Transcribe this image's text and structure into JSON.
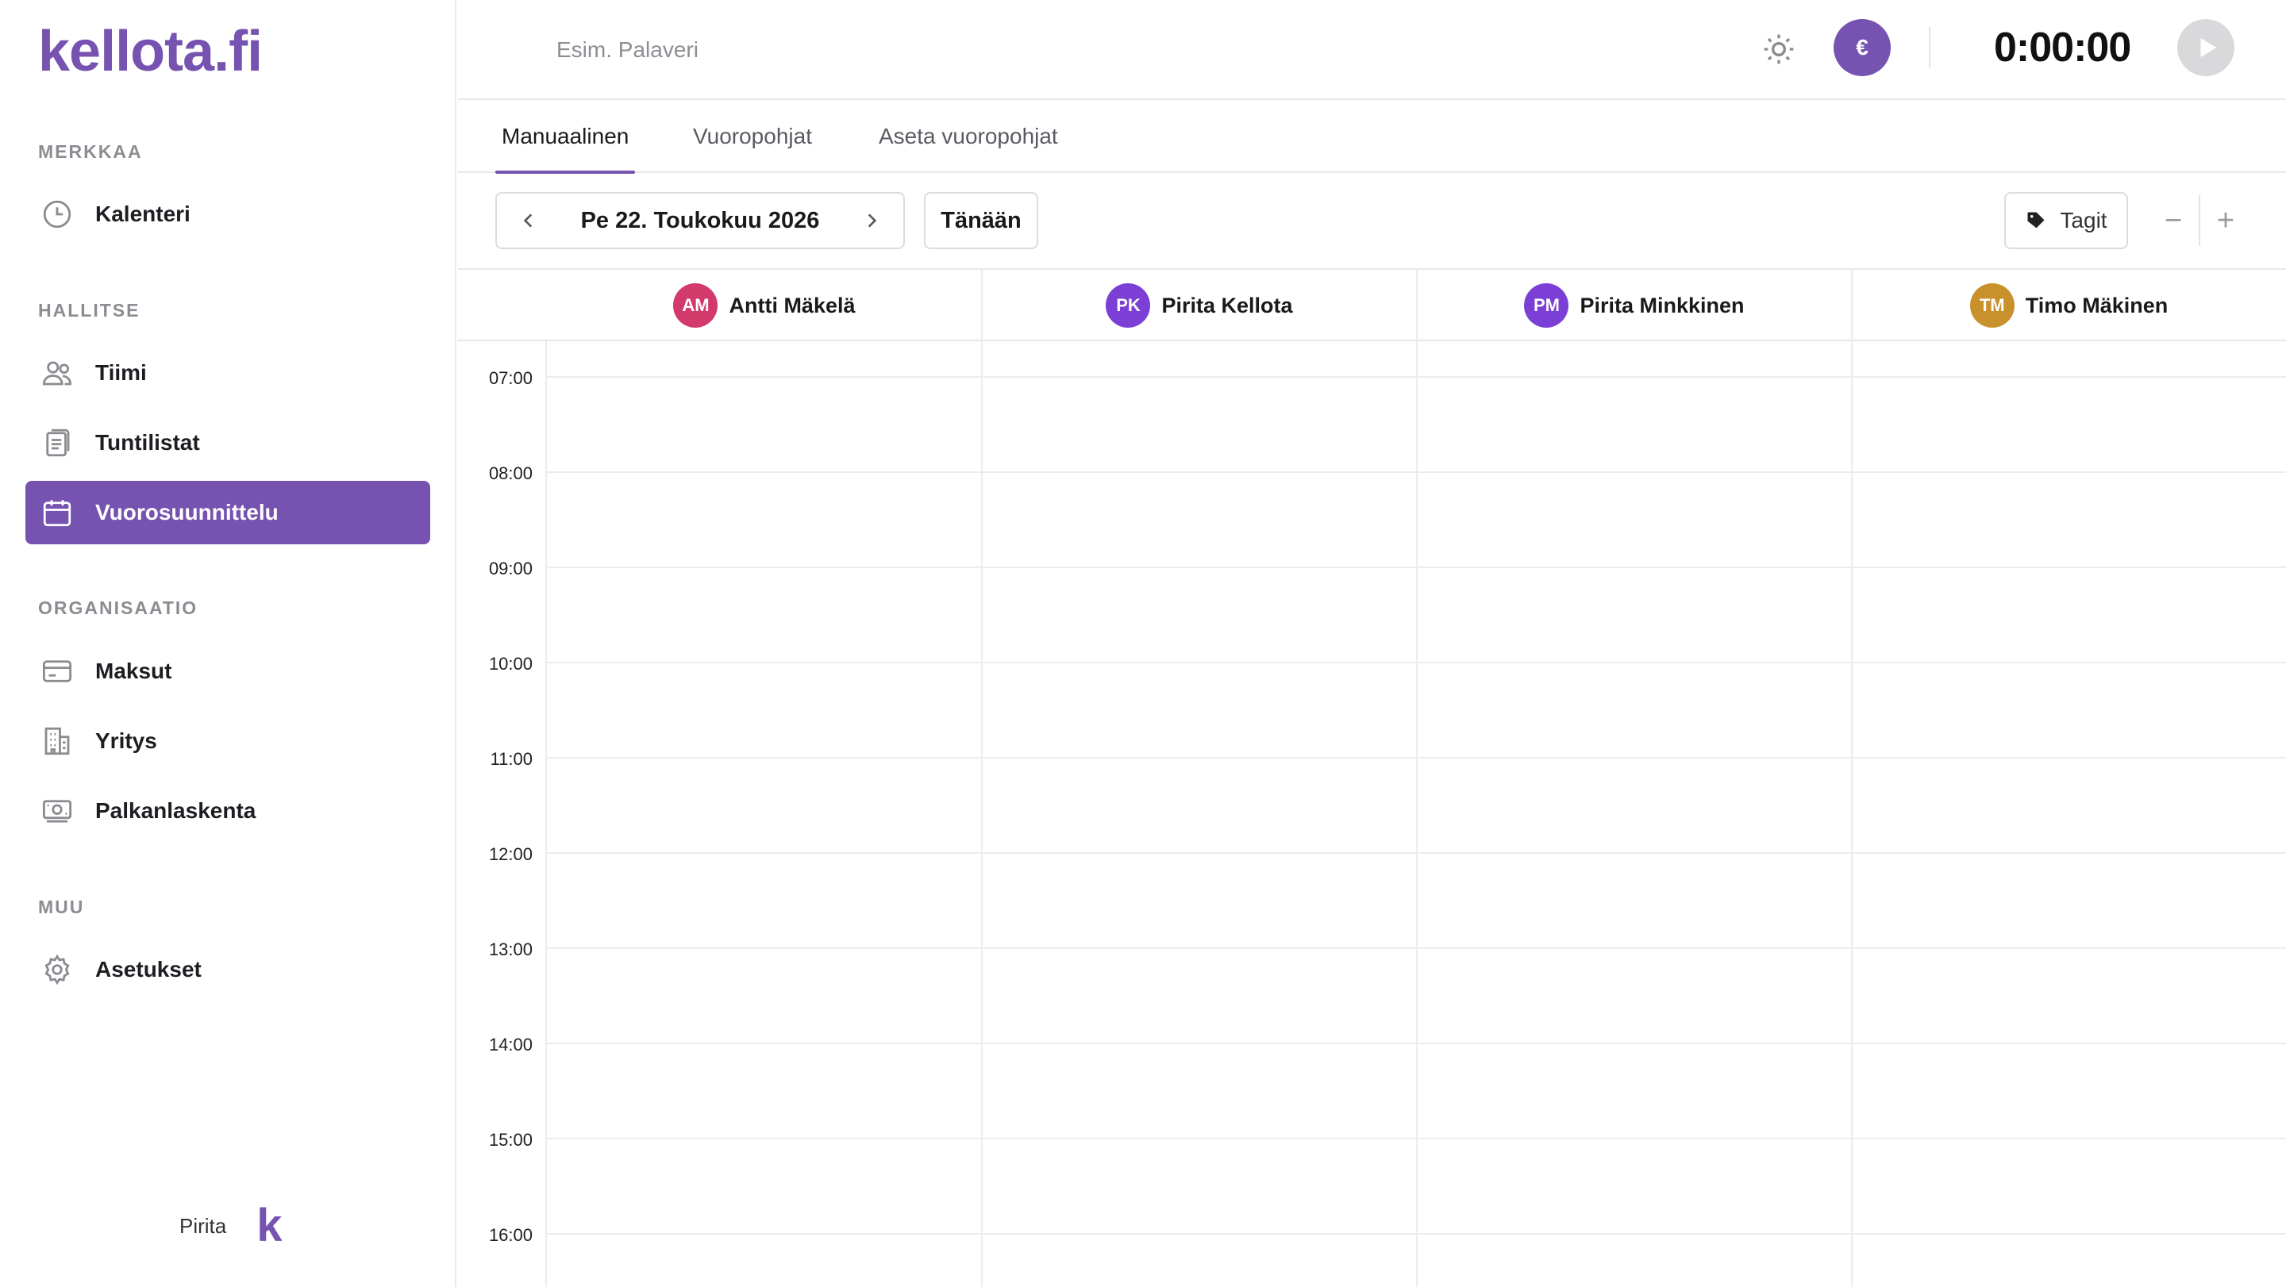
{
  "app": {
    "logo": "kellota.fi"
  },
  "sidebar": {
    "sections": [
      {
        "label": "MERKKAA",
        "items": [
          {
            "label": "Kalenteri",
            "icon": "clock-icon"
          }
        ]
      },
      {
        "label": "HALLITSE",
        "items": [
          {
            "label": "Tiimi",
            "icon": "team-icon"
          },
          {
            "label": "Tuntilistat",
            "icon": "timesheet-icon"
          },
          {
            "label": "Vuorosuunnittelu",
            "icon": "calendar-icon",
            "active": true
          }
        ]
      },
      {
        "label": "ORGANISAATIO",
        "items": [
          {
            "label": "Maksut",
            "icon": "credit-card-icon"
          },
          {
            "label": "Yritys",
            "icon": "building-icon"
          },
          {
            "label": "Palkanlaskenta",
            "icon": "payroll-icon"
          }
        ]
      },
      {
        "label": "MUU",
        "items": [
          {
            "label": "Asetukset",
            "icon": "gear-icon"
          }
        ]
      }
    ],
    "footer": {
      "user": "Pirita",
      "logo_mark": "k"
    }
  },
  "topbar": {
    "task_placeholder": "Esim. Palaveri",
    "theme_icon": "sun-icon",
    "currency_symbol": "€",
    "timer": "0:00:00",
    "play_icon": "play-icon"
  },
  "tabs": [
    {
      "label": "Manuaalinen",
      "active": true
    },
    {
      "label": "Vuoropohjat"
    },
    {
      "label": "Aseta vuoropohjat"
    }
  ],
  "toolbar": {
    "date": "Pe 22. Toukokuu 2026",
    "today_label": "Tänään",
    "tags_label": "Tagit",
    "zoom_out": "−",
    "zoom_in": "+"
  },
  "calendar": {
    "people": [
      {
        "initials": "AM",
        "name": "Antti Mäkelä",
        "color": "#d13a6b"
      },
      {
        "initials": "PK",
        "name": "Pirita Kellota",
        "color": "#7b3fd6"
      },
      {
        "initials": "PM",
        "name": "Pirita Minkkinen",
        "color": "#7b3fd6"
      },
      {
        "initials": "TM",
        "name": "Timo Mäkinen",
        "color": "#c8912c"
      }
    ],
    "hours": [
      "07:00",
      "08:00",
      "09:00",
      "10:00",
      "11:00",
      "12:00",
      "13:00",
      "14:00",
      "15:00",
      "16:00"
    ]
  },
  "colors": {
    "brand": "#7653b0"
  }
}
